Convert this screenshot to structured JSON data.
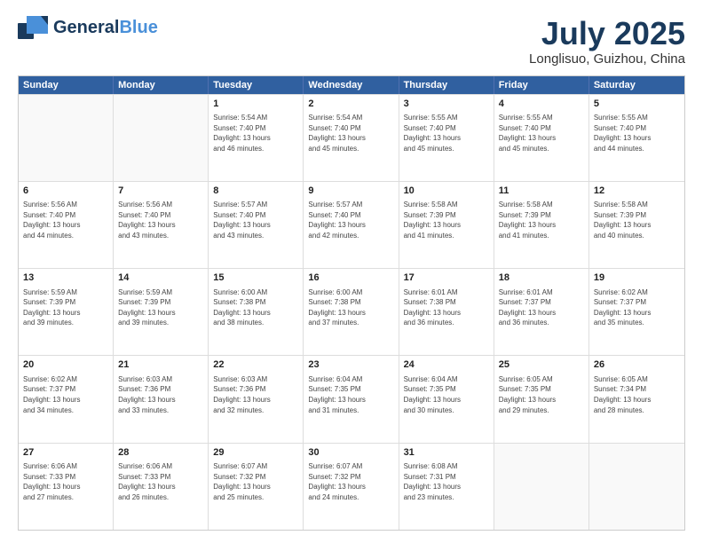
{
  "header": {
    "logo_line1a": "General",
    "logo_line1b": "Blue",
    "title": "July 2025",
    "subtitle": "Longlisuo, Guizhou, China"
  },
  "days_of_week": [
    "Sunday",
    "Monday",
    "Tuesday",
    "Wednesday",
    "Thursday",
    "Friday",
    "Saturday"
  ],
  "weeks": [
    [
      {
        "day": "",
        "info": ""
      },
      {
        "day": "",
        "info": ""
      },
      {
        "day": "1",
        "info": "Sunrise: 5:54 AM\nSunset: 7:40 PM\nDaylight: 13 hours\nand 46 minutes."
      },
      {
        "day": "2",
        "info": "Sunrise: 5:54 AM\nSunset: 7:40 PM\nDaylight: 13 hours\nand 45 minutes."
      },
      {
        "day": "3",
        "info": "Sunrise: 5:55 AM\nSunset: 7:40 PM\nDaylight: 13 hours\nand 45 minutes."
      },
      {
        "day": "4",
        "info": "Sunrise: 5:55 AM\nSunset: 7:40 PM\nDaylight: 13 hours\nand 45 minutes."
      },
      {
        "day": "5",
        "info": "Sunrise: 5:55 AM\nSunset: 7:40 PM\nDaylight: 13 hours\nand 44 minutes."
      }
    ],
    [
      {
        "day": "6",
        "info": "Sunrise: 5:56 AM\nSunset: 7:40 PM\nDaylight: 13 hours\nand 44 minutes."
      },
      {
        "day": "7",
        "info": "Sunrise: 5:56 AM\nSunset: 7:40 PM\nDaylight: 13 hours\nand 43 minutes."
      },
      {
        "day": "8",
        "info": "Sunrise: 5:57 AM\nSunset: 7:40 PM\nDaylight: 13 hours\nand 43 minutes."
      },
      {
        "day": "9",
        "info": "Sunrise: 5:57 AM\nSunset: 7:40 PM\nDaylight: 13 hours\nand 42 minutes."
      },
      {
        "day": "10",
        "info": "Sunrise: 5:58 AM\nSunset: 7:39 PM\nDaylight: 13 hours\nand 41 minutes."
      },
      {
        "day": "11",
        "info": "Sunrise: 5:58 AM\nSunset: 7:39 PM\nDaylight: 13 hours\nand 41 minutes."
      },
      {
        "day": "12",
        "info": "Sunrise: 5:58 AM\nSunset: 7:39 PM\nDaylight: 13 hours\nand 40 minutes."
      }
    ],
    [
      {
        "day": "13",
        "info": "Sunrise: 5:59 AM\nSunset: 7:39 PM\nDaylight: 13 hours\nand 39 minutes."
      },
      {
        "day": "14",
        "info": "Sunrise: 5:59 AM\nSunset: 7:39 PM\nDaylight: 13 hours\nand 39 minutes."
      },
      {
        "day": "15",
        "info": "Sunrise: 6:00 AM\nSunset: 7:38 PM\nDaylight: 13 hours\nand 38 minutes."
      },
      {
        "day": "16",
        "info": "Sunrise: 6:00 AM\nSunset: 7:38 PM\nDaylight: 13 hours\nand 37 minutes."
      },
      {
        "day": "17",
        "info": "Sunrise: 6:01 AM\nSunset: 7:38 PM\nDaylight: 13 hours\nand 36 minutes."
      },
      {
        "day": "18",
        "info": "Sunrise: 6:01 AM\nSunset: 7:37 PM\nDaylight: 13 hours\nand 36 minutes."
      },
      {
        "day": "19",
        "info": "Sunrise: 6:02 AM\nSunset: 7:37 PM\nDaylight: 13 hours\nand 35 minutes."
      }
    ],
    [
      {
        "day": "20",
        "info": "Sunrise: 6:02 AM\nSunset: 7:37 PM\nDaylight: 13 hours\nand 34 minutes."
      },
      {
        "day": "21",
        "info": "Sunrise: 6:03 AM\nSunset: 7:36 PM\nDaylight: 13 hours\nand 33 minutes."
      },
      {
        "day": "22",
        "info": "Sunrise: 6:03 AM\nSunset: 7:36 PM\nDaylight: 13 hours\nand 32 minutes."
      },
      {
        "day": "23",
        "info": "Sunrise: 6:04 AM\nSunset: 7:35 PM\nDaylight: 13 hours\nand 31 minutes."
      },
      {
        "day": "24",
        "info": "Sunrise: 6:04 AM\nSunset: 7:35 PM\nDaylight: 13 hours\nand 30 minutes."
      },
      {
        "day": "25",
        "info": "Sunrise: 6:05 AM\nSunset: 7:35 PM\nDaylight: 13 hours\nand 29 minutes."
      },
      {
        "day": "26",
        "info": "Sunrise: 6:05 AM\nSunset: 7:34 PM\nDaylight: 13 hours\nand 28 minutes."
      }
    ],
    [
      {
        "day": "27",
        "info": "Sunrise: 6:06 AM\nSunset: 7:33 PM\nDaylight: 13 hours\nand 27 minutes."
      },
      {
        "day": "28",
        "info": "Sunrise: 6:06 AM\nSunset: 7:33 PM\nDaylight: 13 hours\nand 26 minutes."
      },
      {
        "day": "29",
        "info": "Sunrise: 6:07 AM\nSunset: 7:32 PM\nDaylight: 13 hours\nand 25 minutes."
      },
      {
        "day": "30",
        "info": "Sunrise: 6:07 AM\nSunset: 7:32 PM\nDaylight: 13 hours\nand 24 minutes."
      },
      {
        "day": "31",
        "info": "Sunrise: 6:08 AM\nSunset: 7:31 PM\nDaylight: 13 hours\nand 23 minutes."
      },
      {
        "day": "",
        "info": ""
      },
      {
        "day": "",
        "info": ""
      }
    ]
  ]
}
